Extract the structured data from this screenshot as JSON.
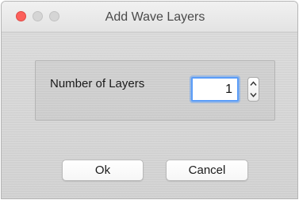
{
  "window": {
    "title": "Add Wave Layers",
    "controls": {
      "close": "close-icon",
      "minimize": "minimize-icon",
      "zoom": "zoom-icon"
    }
  },
  "form": {
    "layers_label": "Number of Layers",
    "layers_value": "1",
    "stepper_icons": {
      "up": "chevron-up-icon",
      "down": "chevron-down-icon"
    }
  },
  "buttons": {
    "ok_label": "Ok",
    "cancel_label": "Cancel"
  },
  "colors": {
    "close": "#fc605b",
    "inactive_control": "#d5d5d5",
    "focus_ring": "#5b9df8"
  }
}
